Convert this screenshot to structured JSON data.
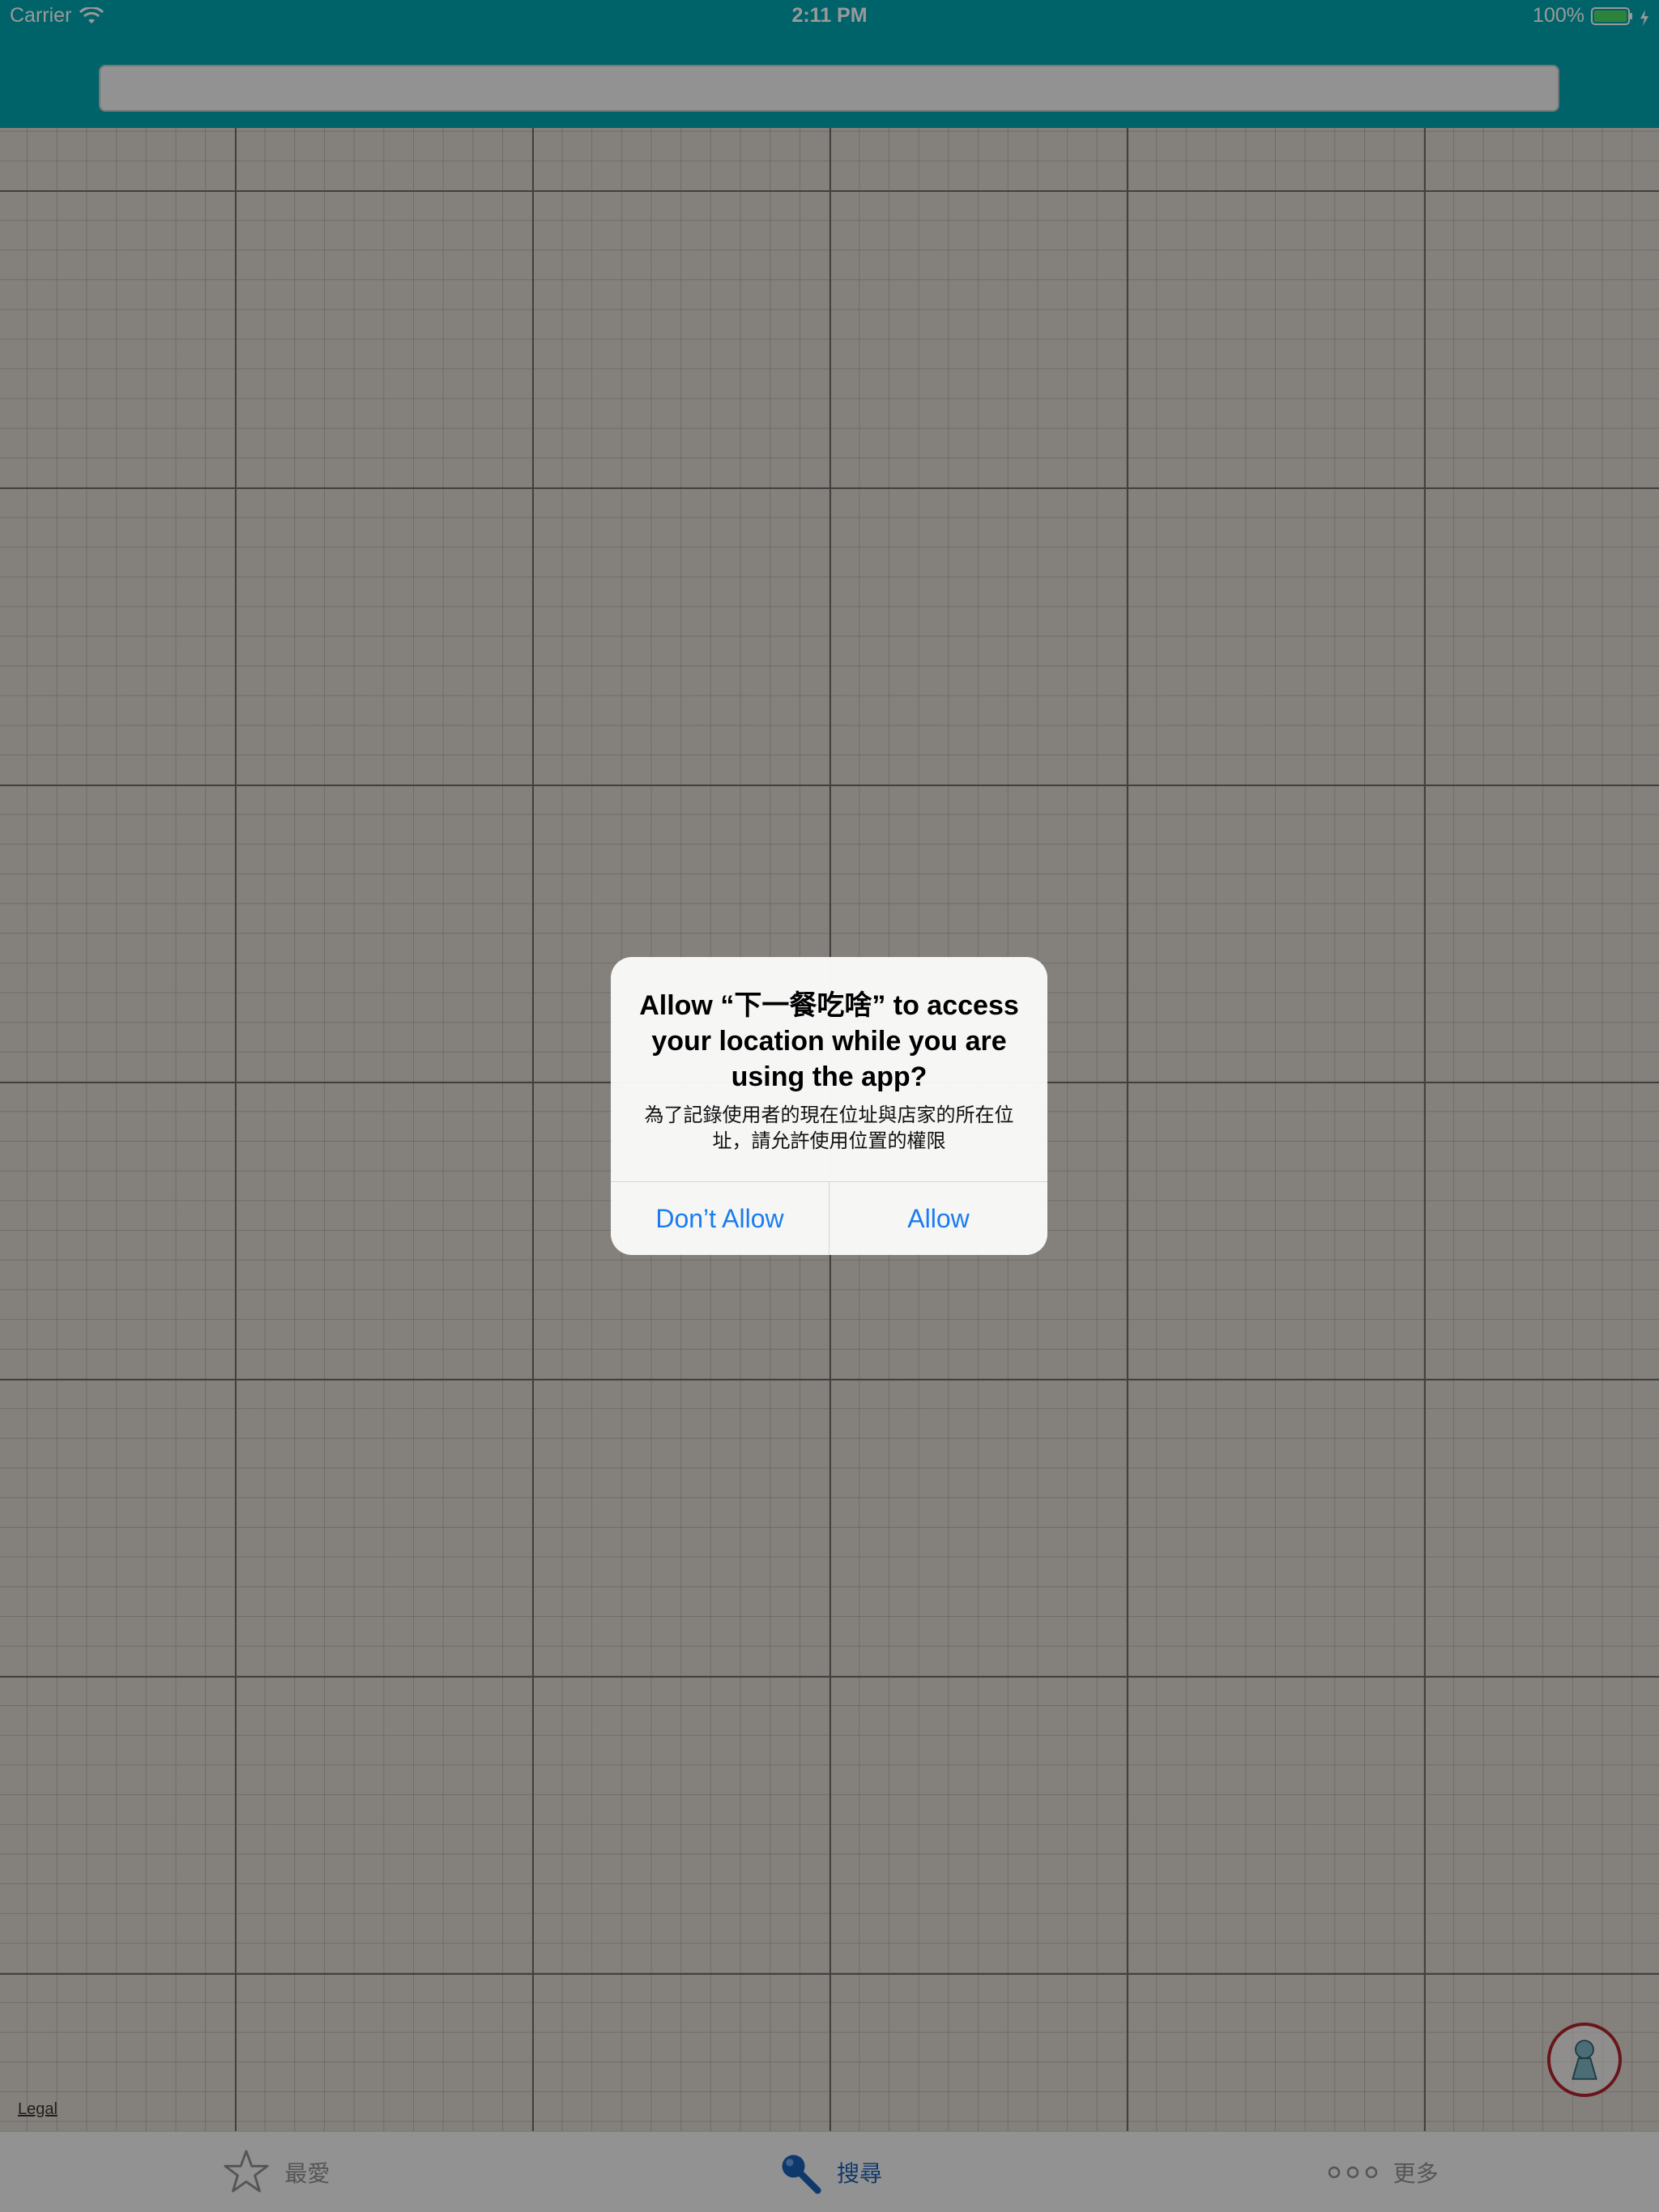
{
  "status_bar": {
    "carrier": "Carrier",
    "time": "2:11 PM",
    "battery": "100%",
    "icons": [
      "wifi-icon",
      "battery-icon",
      "charging-icon"
    ]
  },
  "search": {
    "value": "",
    "placeholder": ""
  },
  "map": {
    "legal_label": "Legal"
  },
  "tab_bar": {
    "items": [
      {
        "label": "最愛",
        "icon": "star-icon",
        "active": false
      },
      {
        "label": "搜尋",
        "icon": "magnifier-icon",
        "active": true
      },
      {
        "label": "更多",
        "icon": "more-dots-icon",
        "active": false
      }
    ]
  },
  "alert": {
    "title": "Allow “下一餐吃啥” to access your location while you are using the app?",
    "message": "為了記錄使用者的現在位址與店家的所在位址，請允許使用位置的權限",
    "dont_allow_label": "Don’t Allow",
    "allow_label": "Allow"
  },
  "colors": {
    "header": "#00a6b0",
    "accent": "#1a7cf0",
    "tab_active": "#1a5fb4",
    "location_ring": "#b0242c"
  }
}
